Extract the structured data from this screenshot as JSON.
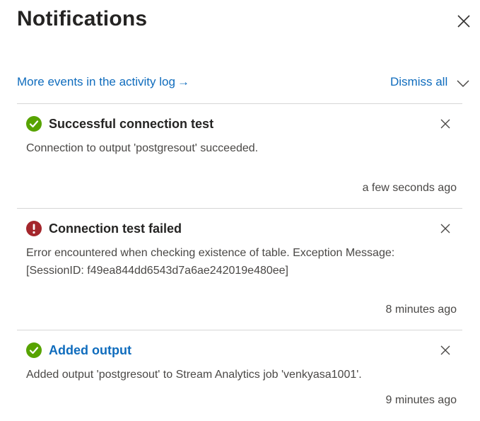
{
  "panel": {
    "title": "Notifications"
  },
  "toolbar": {
    "activity_link": "More events in the activity log",
    "activity_arrow": "→",
    "dismiss_all": "Dismiss all"
  },
  "notifications": [
    {
      "status": "success",
      "icon": "check-circle-icon",
      "title": "Successful connection test",
      "message": "Connection to output 'postgresout' succeeded.",
      "time": "a few seconds ago"
    },
    {
      "status": "error",
      "icon": "error-circle-icon",
      "title": "Connection test failed",
      "message": "Error encountered when checking existence of table.  Exception Message: [SessionID: f49ea844dd6543d7a6ae242019e480ee]",
      "time": "8 minutes ago"
    },
    {
      "status": "success",
      "icon": "check-circle-icon",
      "title": "Added output",
      "message": "Added output 'postgresout' to Stream Analytics job 'venkyasa1001'.",
      "time": "9 minutes ago"
    }
  ],
  "colors": {
    "success": "#57a300",
    "error": "#a4262c",
    "link": "#0f6cbd",
    "divider": "#d6d6d6"
  }
}
